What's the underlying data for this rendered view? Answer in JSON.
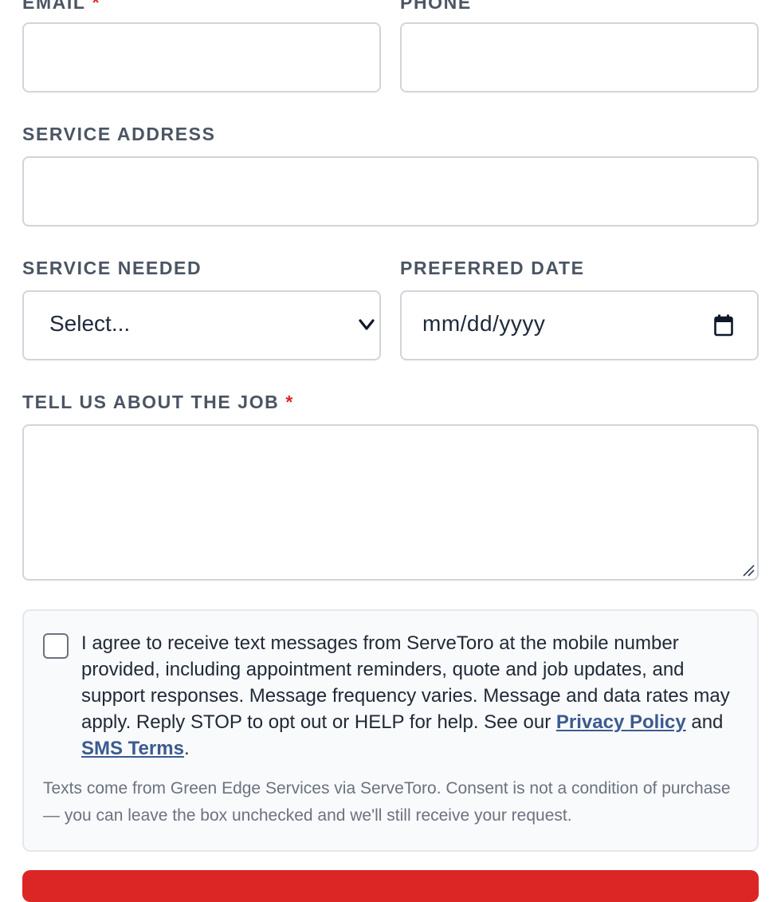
{
  "form": {
    "email": {
      "label": "EMAIL",
      "required_mark": "*",
      "value": ""
    },
    "phone": {
      "label": "PHONE",
      "value": ""
    },
    "address": {
      "label": "SERVICE ADDRESS",
      "value": ""
    },
    "service": {
      "label": "SERVICE NEEDED",
      "selected": "Select..."
    },
    "date": {
      "label": "PREFERRED DATE",
      "placeholder": "mm/dd/yyyy"
    },
    "job": {
      "label": "TELL US ABOUT THE JOB",
      "required_mark": "*",
      "value": ""
    }
  },
  "consent": {
    "checked": false,
    "text_before": "I agree to receive text messages from ServeToro at the mobile number provided, including appointment reminders, quote and job updates, and support responses. Message frequency varies. Message and data rates may apply. Reply STOP to opt out or HELP for help. See our ",
    "privacy_link": "Privacy Policy",
    "text_and": " and ",
    "sms_link": "SMS Terms",
    "text_end": ".",
    "note": "Texts come from Green Edge Services via ServeToro. Consent is not a condition of purchase — you can leave the box unchecked and we'll still receive your request."
  },
  "icons": {
    "select_chevron": "chevron-down-icon",
    "date_picker": "calendar-icon",
    "textarea_resize": "resize-grip-icon"
  },
  "colors": {
    "required": "#dc2626",
    "link": "#3b5b8f",
    "submit_button": "#dc2626"
  }
}
